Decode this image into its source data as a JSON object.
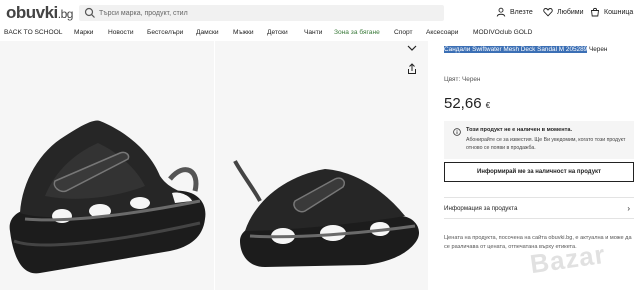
{
  "header": {
    "logo": "obuvki",
    "logo_suffix": ".bg",
    "search_placeholder": "Търси марка, продукт, стил",
    "login": "Влезте",
    "favorites": "Любими",
    "cart": "Кошница"
  },
  "nav": {
    "items": [
      "BACK TO SCHOOL",
      "Марки",
      "Новости",
      "Бестселъри",
      "Дамски",
      "Мъжки",
      "Детски",
      "Чанти",
      "Зона за бягане",
      "Спорт",
      "Аксесоари",
      "MODIVOclub GOLD"
    ]
  },
  "product": {
    "title_selected": "Сандали Swiftwater Mesh Deck Sandal M 205289",
    "title_rest": " Черен",
    "color_label": "Цвят:",
    "color_value": "Черен",
    "price": "52,66",
    "currency": "€"
  },
  "notice": {
    "title": "Този продукт не е наличен в момента.",
    "text": "Абонирайте се за известия. Ще Ви уведомим, когато този продукт отново се появи в продажба."
  },
  "buttons": {
    "inform": "Информирай ме за наличност на продукт"
  },
  "info": {
    "label": "Информация за продукта"
  },
  "disclaimer": "Цената на продукта, посочена на сайта obuvki.bg, е актуална и може да се различава от цената, отпечатана върху етикета.",
  "watermark": "Bazar",
  "colors": {
    "accent_green": "#3a7a3a",
    "selection": "#3b6fb5"
  }
}
